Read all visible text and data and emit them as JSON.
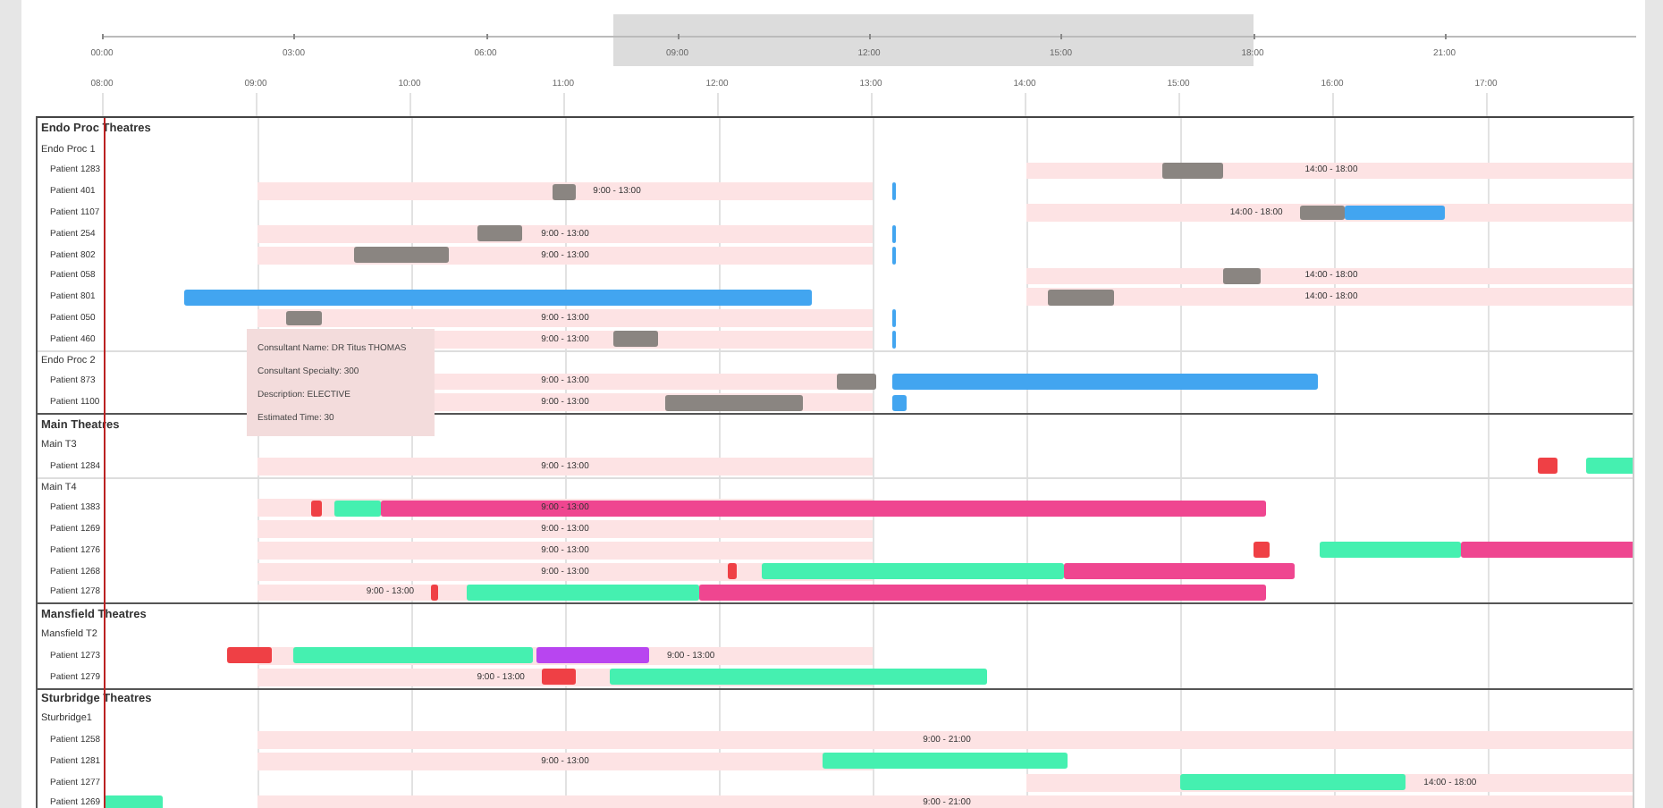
{
  "overview": {
    "ticks": [
      "00:00",
      "03:00",
      "06:00",
      "09:00",
      "12:00",
      "15:00",
      "18:00",
      "21:00"
    ]
  },
  "timeline": {
    "ticks": [
      "08:00",
      "09:00",
      "10:00",
      "11:00",
      "12:00",
      "13:00",
      "14:00",
      "15:00",
      "16:00",
      "17:00"
    ]
  },
  "groups": [
    {
      "name": "Endo Proc Theatres",
      "theatres": [
        {
          "name": "Endo Proc 1",
          "patients": [
            {
              "name": "Patient 1283",
              "session": {
                "label": "14:00 - 18:00"
              },
              "bars": [
                {
                  "kind": "bar",
                  "color": "#8a8581"
                }
              ]
            },
            {
              "name": "Patient 401",
              "session": {
                "label": "9:00 - 13:00"
              },
              "bars": [
                {
                  "kind": "bar",
                  "color": "#8a8581"
                },
                {
                  "kind": "marker",
                  "color": "#42a5f0"
                }
              ]
            },
            {
              "name": "Patient 1107",
              "session": {
                "label": "14:00 - 18:00"
              },
              "bars": [
                {
                  "kind": "bar",
                  "color": "#8a8581"
                },
                {
                  "kind": "bar",
                  "color": "#42a5f0"
                }
              ]
            },
            {
              "name": "Patient 254",
              "session": {
                "label": "9:00 - 13:00"
              },
              "bars": [
                {
                  "kind": "bar",
                  "color": "#8a8581"
                },
                {
                  "kind": "marker",
                  "color": "#42a5f0"
                }
              ]
            },
            {
              "name": "Patient 802",
              "session": {
                "label": "9:00 - 13:00"
              },
              "bars": [
                {
                  "kind": "bar",
                  "color": "#8a8581"
                },
                {
                  "kind": "marker",
                  "color": "#42a5f0"
                }
              ]
            },
            {
              "name": "Patient 058",
              "session": {
                "label": "14:00 - 18:00"
              },
              "bars": [
                {
                  "kind": "bar",
                  "color": "#8a8581"
                }
              ]
            },
            {
              "name": "Patient 801",
              "session": {
                "label": "14:00 - 18:00"
              },
              "bars": [
                {
                  "kind": "bar",
                  "color": "#42a5f0"
                },
                {
                  "kind": "bar",
                  "color": "#8a8581"
                }
              ]
            },
            {
              "name": "Patient 050",
              "session": {
                "label": "9:00 - 13:00"
              },
              "bars": [
                {
                  "kind": "bar",
                  "color": "#8a8581"
                },
                {
                  "kind": "marker",
                  "color": "#42a5f0"
                }
              ]
            },
            {
              "name": "Patient 460",
              "session": {
                "label": "9:00 - 13:00"
              },
              "bars": [
                {
                  "kind": "bar",
                  "color": "#8a8581"
                },
                {
                  "kind": "marker",
                  "color": "#42a5f0"
                }
              ]
            }
          ]
        },
        {
          "name": "Endo Proc 2",
          "patients": [
            {
              "name": "Patient 873",
              "session": {
                "label": "9:00 - 13:00"
              },
              "bars": [
                {
                  "kind": "bar",
                  "color": "#8a8581"
                },
                {
                  "kind": "bar",
                  "color": "#42a5f0"
                }
              ]
            },
            {
              "name": "Patient 1100",
              "session": {
                "label": "9:00 - 13:00"
              },
              "bars": [
                {
                  "kind": "bar",
                  "color": "#8a8581"
                },
                {
                  "kind": "bar",
                  "color": "#42a5f0"
                }
              ]
            }
          ]
        }
      ]
    },
    {
      "name": "Main Theatres",
      "theatres": [
        {
          "name": "Main T3",
          "patients": [
            {
              "name": "Patient 1284",
              "session": {
                "label": "9:00 - 13:00"
              },
              "bars": [
                {
                  "kind": "bar",
                  "color": "#ef4045"
                },
                {
                  "kind": "bar",
                  "color": "#45f0b0"
                }
              ]
            }
          ]
        },
        {
          "name": "Main T4",
          "patients": [
            {
              "name": "Patient 1383",
              "session": {
                "label": "9:00 - 13:00"
              },
              "bars": [
                {
                  "kind": "bar",
                  "color": "#ef4045"
                },
                {
                  "kind": "bar",
                  "color": "#45f0b0"
                },
                {
                  "kind": "bar",
                  "color": "#ef4690"
                }
              ]
            },
            {
              "name": "Patient 1269",
              "session": {
                "label": "9:00 - 13:00"
              }
            },
            {
              "name": "Patient 1276",
              "session": {
                "label": "9:00 - 13:00"
              },
              "bars": [
                {
                  "kind": "bar",
                  "color": "#ef4045"
                },
                {
                  "kind": "bar",
                  "color": "#45f0b0"
                },
                {
                  "kind": "bar",
                  "color": "#ef4690"
                }
              ]
            },
            {
              "name": "Patient 1268",
              "session": {
                "label": "9:00 - 13:00"
              },
              "bars": [
                {
                  "kind": "bar",
                  "color": "#ef4045"
                },
                {
                  "kind": "bar",
                  "color": "#45f0b0"
                },
                {
                  "kind": "bar",
                  "color": "#ef4690"
                }
              ]
            },
            {
              "name": "Patient 1278",
              "session": {
                "label": "9:00 - 13:00"
              },
              "bars": [
                {
                  "kind": "bar",
                  "color": "#ef4045"
                },
                {
                  "kind": "bar",
                  "color": "#45f0b0"
                },
                {
                  "kind": "bar",
                  "color": "#ef4690"
                }
              ]
            }
          ]
        }
      ]
    },
    {
      "name": "Mansfield Theatres",
      "theatres": [
        {
          "name": "Mansfield T2",
          "patients": [
            {
              "name": "Patient 1273",
              "session": {
                "label": "9:00 - 13:00"
              },
              "bars": [
                {
                  "kind": "bar",
                  "color": "#ef4045"
                },
                {
                  "kind": "bar",
                  "color": "#45f0b0"
                },
                {
                  "kind": "bar",
                  "color": "#b845f0"
                }
              ]
            },
            {
              "name": "Patient 1279",
              "session": {
                "label": "9:00 - 13:00"
              },
              "bars": [
                {
                  "kind": "bar",
                  "color": "#ef4045"
                },
                {
                  "kind": "bar",
                  "color": "#45f0b0"
                }
              ]
            }
          ]
        }
      ]
    },
    {
      "name": "Sturbridge Theatres",
      "theatres": [
        {
          "name": "Sturbridge1",
          "patients": [
            {
              "name": "Patient 1258",
              "session": {
                "label": "9:00 - 21:00"
              }
            },
            {
              "name": "Patient 1281",
              "session": {
                "label": "9:00 - 13:00"
              },
              "bars": [
                {
                  "kind": "bar",
                  "color": "#45f0b0"
                }
              ]
            },
            {
              "name": "Patient 1277",
              "session": {
                "label": "14:00 - 18:00"
              },
              "bars": [
                {
                  "kind": "bar",
                  "color": "#45f0b0"
                }
              ]
            },
            {
              "name": "Patient 1269",
              "session": {
                "label": "9:00 - 21:00"
              },
              "bars": [
                {
                  "kind": "bar",
                  "color": "#45f0b0"
                }
              ]
            }
          ]
        }
      ]
    }
  ],
  "tooltip": {
    "lines": [
      "Consultant Name: DR Titus THOMAS",
      "Consultant Specialty: 300",
      "Description: ELECTIVE",
      "Estimated Time: 30"
    ]
  }
}
